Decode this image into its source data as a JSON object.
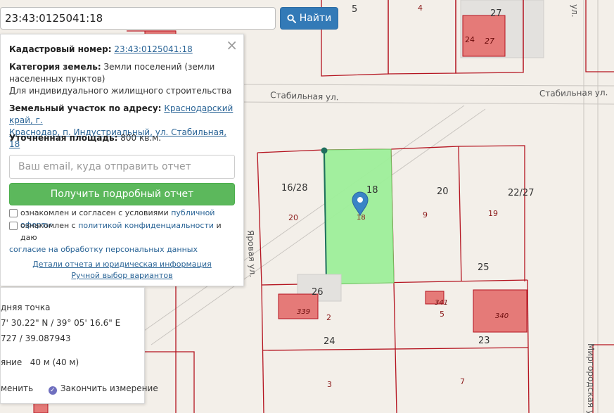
{
  "search": {
    "query": "23:43:0125041:18",
    "button_label": "Найти",
    "icon": "search-icon"
  },
  "popup": {
    "cadastral_label": "Кадастровый номер:",
    "cadastral_value": "23:43:0125041:18",
    "category_label": "Категория земель:",
    "category_value_1": "Земли поселений (земли",
    "category_value_2": "населенных пунктов)",
    "category_value_3": "Для индивидуального жилищного строительства",
    "address_label": "Земельный участок по адресу:",
    "address_value_1": "Краснодарский край, г.",
    "address_value_2": "Краснодар, п. Индустриальный, ул. Стабильная, 18",
    "area_label": "Уточненная площадь:",
    "area_value": "800 кв.м.",
    "email_placeholder": "Ваш email, куда отправить отчет",
    "report_button": "Получить подробный отчет",
    "agree1_prefix": "ознакомлен и согласен с условиями",
    "agree1_link": "публичной оферты",
    "agree2_prefix": "ознакомлен с",
    "agree2_link": "политикой конфиденциальности",
    "agree2_mid": "и даю",
    "agree2_link2": "согласие на обработку персональных данных",
    "details_link": "Детали отчета и юридическая информация",
    "manual_link": "Ручной выбор вариантов",
    "close_glyph": "×"
  },
  "measure": {
    "point_label": "дняя точка",
    "coords_dms": "7' 30.22\" N / 39° 05' 16.6\" E",
    "coords_dec": "727 / 39.087943",
    "distance_label": "яние",
    "distance_value": "40 м (40 м)",
    "cancel_label": "менить",
    "finish_label": "Закончить измерение"
  },
  "map": {
    "streets": {
      "stabilnaya_1": "Стабильная ул.",
      "stabilnaya_2": "Стабильная ул.",
      "yarovaya": "Яровая ул.",
      "mirgorodskaya": "Миргородская ул.",
      "top_street": "ул."
    },
    "parcels": {
      "p5": "5",
      "p4": "4",
      "p27": "27",
      "p24b": "24",
      "p27b": "27",
      "p16_28": "16/28",
      "p20a": "20",
      "p18": "18",
      "p18s": "18",
      "p20": "20",
      "p9": "9",
      "p22_27": "22/27",
      "p19": "19",
      "p25": "25",
      "p26": "26",
      "p339": "339",
      "p2": "2",
      "p341": "341",
      "p5b": "5",
      "p340": "340",
      "p24": "24",
      "p23": "23",
      "p3": "3",
      "p7": "7"
    },
    "colors": {
      "parcel_border": "#b4131f",
      "selected_fill": "#9ef09a",
      "building": "#e57a78",
      "marker": "#3a84c6"
    }
  }
}
